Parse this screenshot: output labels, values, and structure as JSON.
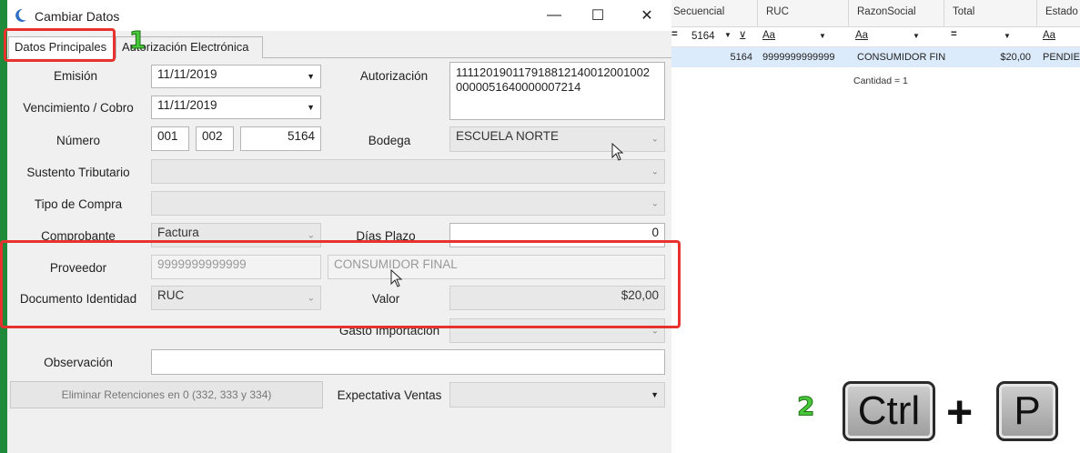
{
  "window": {
    "title": "Cambiar Datos",
    "minimize_glyph": "—",
    "maximize_glyph": "☐",
    "close_glyph": "✕"
  },
  "tabs": [
    {
      "label": "Datos Principales",
      "active": true
    },
    {
      "label": "Autorización Electrónica",
      "active": false
    }
  ],
  "form": {
    "emision": {
      "label": "Emisión",
      "value": "11/11/2019"
    },
    "vencimiento": {
      "label": "Vencimiento / Cobro",
      "value": "11/11/2019"
    },
    "numero": {
      "label": "Número",
      "serie1": "001",
      "serie2": "002",
      "secuencial": "5164"
    },
    "autorizacion": {
      "label": "Autorización",
      "line1": "111120190117918812140012001002",
      "line2": "0000051640000007214"
    },
    "bodega": {
      "label": "Bodega",
      "value": "ESCUELA NORTE"
    },
    "sustento": {
      "label": "Sustento Tributario",
      "value": ""
    },
    "tipo_compra": {
      "label": "Tipo de Compra",
      "value": ""
    },
    "comprobante": {
      "label": "Comprobante",
      "value": "Factura"
    },
    "dias_plazo": {
      "label": "Días Plazo",
      "value": "0"
    },
    "proveedor": {
      "label": "Proveedor",
      "ruc": "9999999999999",
      "nombre": "CONSUMIDOR FINAL"
    },
    "documento": {
      "label": "Documento Identidad",
      "value": "RUC"
    },
    "valor": {
      "label": "Valor",
      "value": "$20,00"
    },
    "gasto": {
      "label": "Gasto Importación",
      "value": ""
    },
    "observacion": {
      "label": "Observación",
      "value": ""
    },
    "eliminar_button": "Eliminar Retenciones en 0 (332, 333 y 334)",
    "expectativa": {
      "label": "Expectativa Ventas",
      "value": ""
    }
  },
  "grid": {
    "columns": [
      "Secuencial",
      "RUC",
      "RazonSocial",
      "Total",
      "Estado"
    ],
    "filter": {
      "secuencial": "5164",
      "ruc": "Aa",
      "razon": "Aa",
      "total": "=",
      "estado": "Aa",
      "eq": "="
    },
    "row": {
      "secuencial": "5164",
      "ruc": "9999999999999",
      "razon": "CONSUMIDOR FIN",
      "total": "$20,00",
      "estado": "PENDIEN"
    },
    "footer": "Cantidad = 1"
  },
  "annotations": {
    "step1": "1",
    "step2": "2",
    "key_ctrl": "Ctrl",
    "key_plus": "+",
    "key_p": "P"
  },
  "colors": {
    "annotation_red": "#e8322d",
    "annotation_green": "#46c83a",
    "selection_blue": "#dcebfb"
  }
}
